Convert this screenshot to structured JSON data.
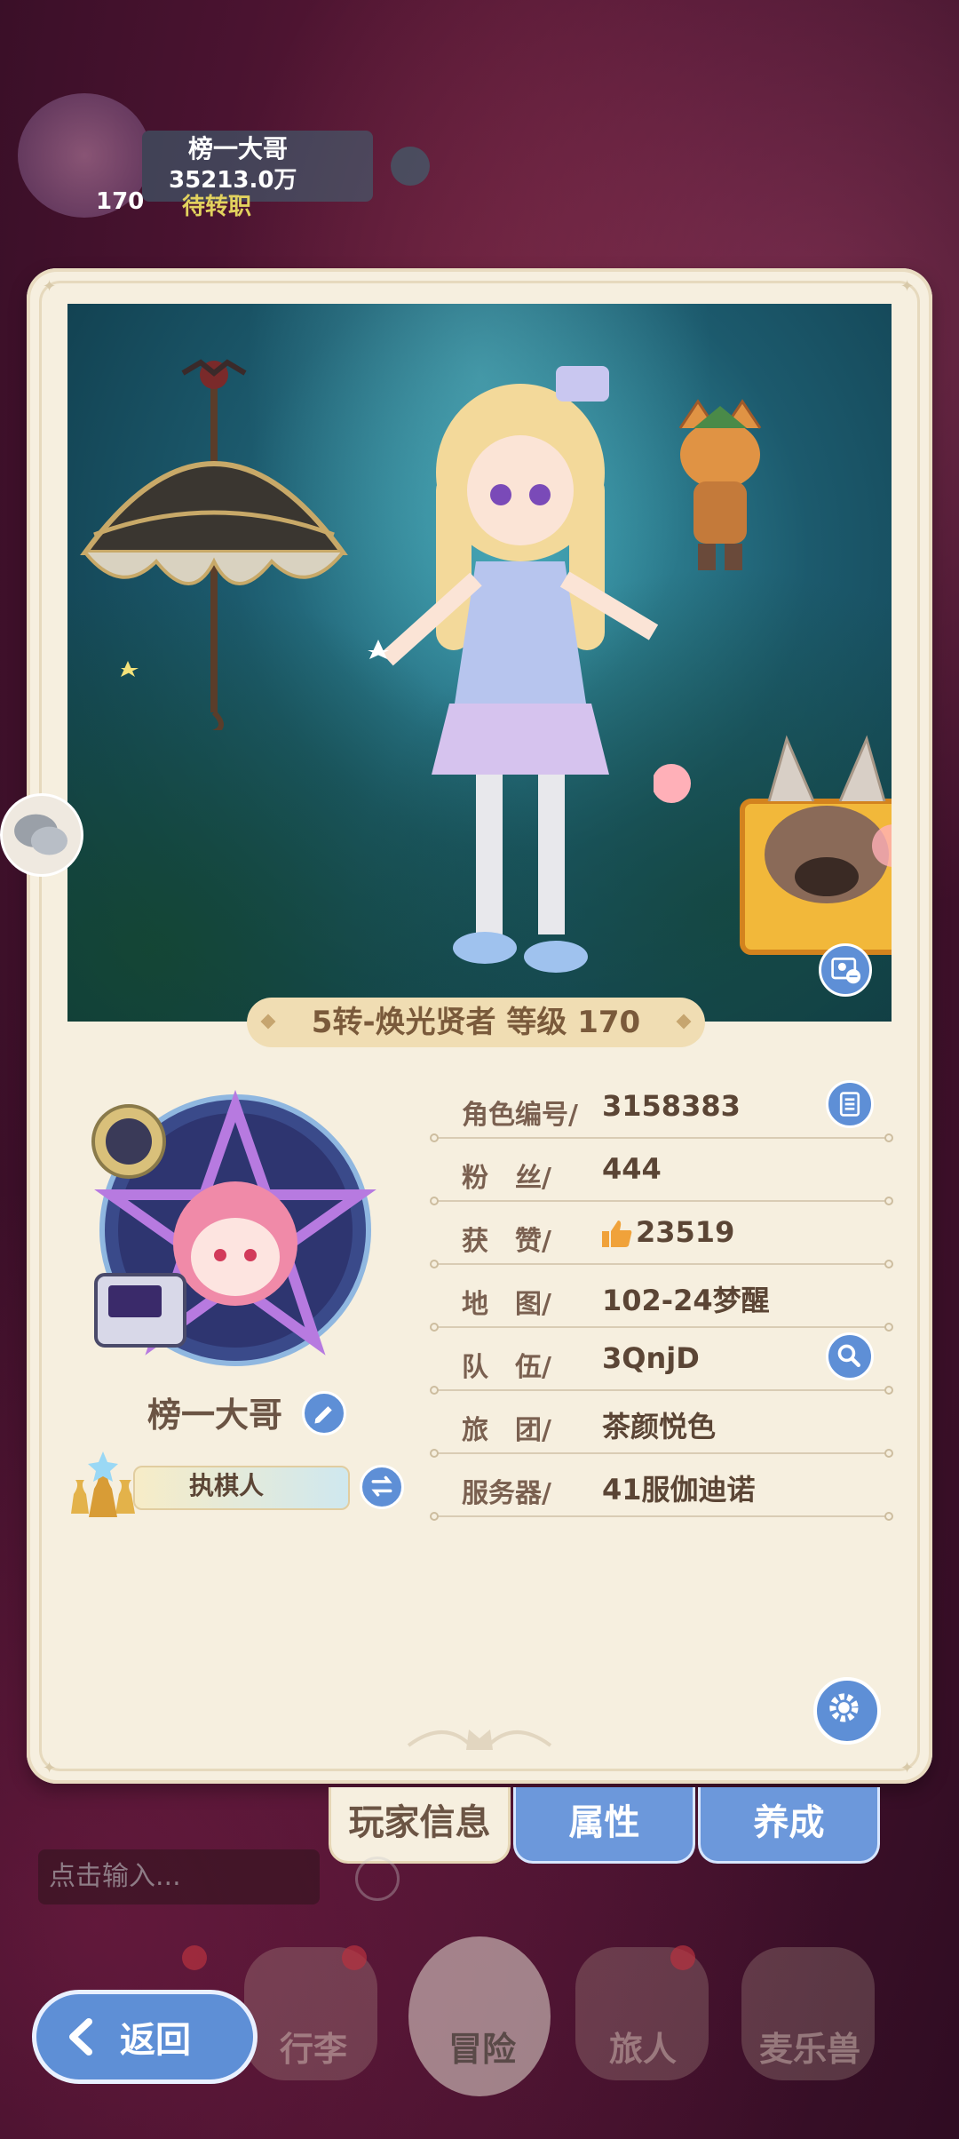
{
  "hud": {
    "name": "榜一大哥",
    "score": "35213.0万",
    "level": "170",
    "status": "待转职"
  },
  "scene": {
    "class_banner": "5转-焕光贤者 等级 170"
  },
  "player": {
    "name": "榜一大哥",
    "title": "执棋人"
  },
  "info": {
    "rows": [
      {
        "label": "角色编号/",
        "value": "3158383"
      },
      {
        "label": "粉　丝/",
        "value": "444"
      },
      {
        "label": "获　赞/",
        "value": "23519"
      },
      {
        "label": "地　图/",
        "value": "102-24梦醒"
      },
      {
        "label": "队　伍/",
        "value": "3QnjD"
      },
      {
        "label": "旅　团/",
        "value": "茶颜悦色"
      },
      {
        "label": "服务器/",
        "value": "41服伽迪诺"
      }
    ]
  },
  "tabs": [
    "玩家信息",
    "属性",
    "养成"
  ],
  "chat": {
    "placeholder": "点击输入..."
  },
  "nav": {
    "back": "返回",
    "items": [
      "行李",
      "冒险",
      "旅人",
      "麦乐兽"
    ]
  },
  "colors": {
    "accent_blue": "#5e8fd6",
    "panel": "#f6efdf",
    "text_brown": "#5b4535"
  },
  "icons": {
    "info_row_0": "list-icon",
    "info_row_4": "search-icon",
    "likes": "thumb-up-icon",
    "settings": "gear-icon"
  }
}
